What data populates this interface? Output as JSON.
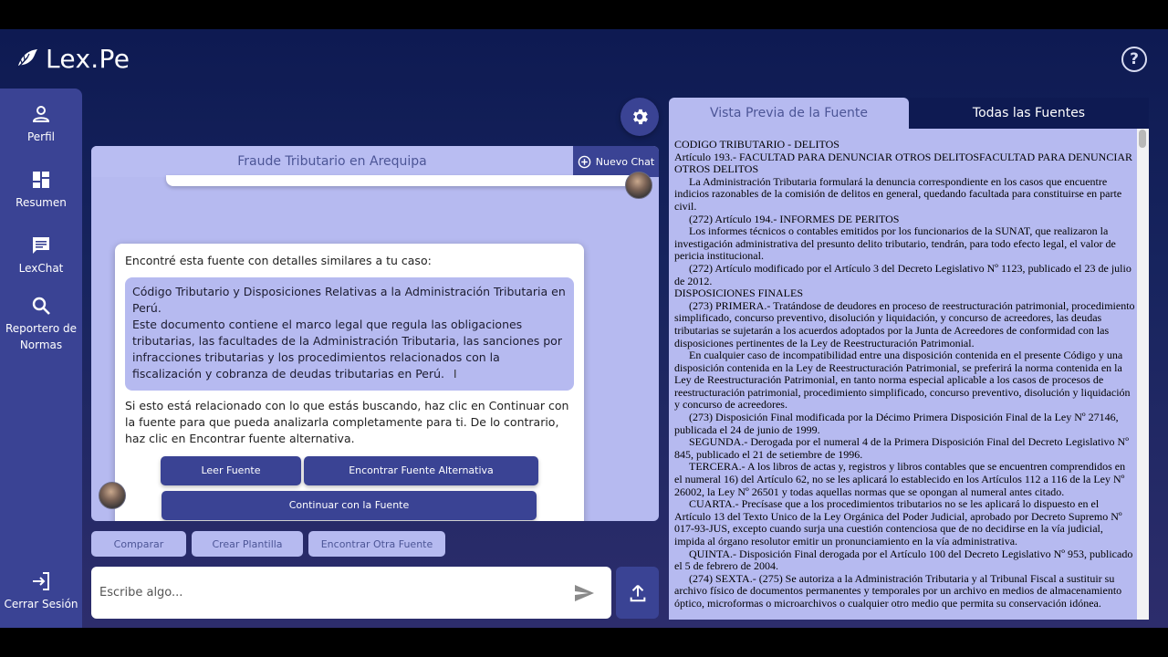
{
  "app": {
    "logo_text": "Lex.Pe"
  },
  "sidebar": {
    "items": [
      {
        "label": "Perfil",
        "icon": "person-icon"
      },
      {
        "label": "Resumen",
        "icon": "dashboard-icon"
      },
      {
        "label": "LexChat",
        "icon": "chat-icon"
      },
      {
        "label": "Reportero de Normas",
        "icon": "search-icon"
      }
    ],
    "logout_label": "Cerrar Sesión"
  },
  "chat": {
    "title": "Fraude Tributario en Arequipa",
    "new_chat_label": "Nuevo Chat",
    "bot_message": {
      "intro": "Encontré esta fuente con detalles similares a tu caso:",
      "source_title": "Código Tributario y Disposiciones Relativas a la Administración Tributaria en Perú.",
      "source_description": "Este documento contiene el marco legal que regula las obligaciones tributarias, las facultades de la Administración Tributaria, las sanciones por infracciones tributarias y los procedimientos relacionados con la fiscalización y cobranza de deudas tributarias en Perú.",
      "followup": "Si esto está relacionado con lo que estás buscando, haz clic en Continuar con la fuente para que pueda analizarla completamente para ti. De lo contrario, haz clic en Encontrar fuente alternativa.",
      "buttons": {
        "read": "Leer Fuente",
        "alternative": "Encontrar Fuente Alternativa",
        "continue": "Continuar con la Fuente"
      }
    },
    "quick_actions": [
      "Comparar",
      "Crear Plantilla",
      "Encontrar Otra Fuente"
    ],
    "input_placeholder": "Escribe algo..."
  },
  "source_panel": {
    "tabs": [
      "Vista Previa de la Fuente",
      "Todas las Fuentes"
    ],
    "paragraphs": [
      {
        "text": "CODIGO TRIBUTARIO - DELITOS",
        "indent": false
      },
      {
        "text": "Artículo 193.- FACULTAD PARA DENUNCIAR OTROS DELITOSFACULTAD PARA DENUNCIAR OTROS DELITOS",
        "indent": false
      },
      {
        "text": "La Administración Tributaria formulará la denuncia correspondiente en los casos que encuentre indicios razonables de la comisión de delitos en general, quedando facultada para constituirse en parte civil.",
        "indent": true
      },
      {
        "text": "(272) Artículo 194.- INFORMES DE PERITOS",
        "indent": true
      },
      {
        "text": "Los informes técnicos o contables emitidos por los funcionarios de la SUNAT, que realizaron la investigación administrativa del presunto delito tributario, tendrán, para todo efecto legal, el valor de pericia institucional.",
        "indent": true
      },
      {
        "text": "(272) Artículo modificado por el Artículo 3 del Decreto Legislativo Nº 1123, publicado el 23 de julio de 2012.",
        "indent": true
      },
      {
        "text": "DISPOSICIONES FINALES",
        "indent": false
      },
      {
        "text": "(273) PRIMERA.- Tratándose de deudores en proceso de reestructuración patrimonial, procedimiento simplificado, concurso preventivo, disolución y liquidación, y concurso de acreedores, las deudas tributarias se sujetarán a los acuerdos adoptados por la Junta de Acreedores de conformidad con las disposiciones pertinentes de la Ley de Reestructuración Patrimonial.",
        "indent": true
      },
      {
        "text": "En cualquier caso de incompatibilidad entre una disposición contenida en el presente Código y una disposición contenida en la Ley de Reestructuración Patrimonial, se preferirá la norma contenida en la Ley de Reestructuración Patrimonial, en tanto norma especial aplicable a los casos de procesos de reestructuración patrimonial, procedimiento simplificado, concurso preventivo, disolución y liquidación y concurso de acreedores.",
        "indent": true
      },
      {
        "text": "(273) Disposición Final modificada por la Décimo Primera Disposición Final de la Ley Nº 27146, publicada el 24 de junio de 1999.",
        "indent": true
      },
      {
        "text": "SEGUNDA.- Derogada por el numeral 4 de la Primera Disposición Final del Decreto Legislativo Nº 845, publicado el 21 de setiembre de 1996.",
        "indent": true
      },
      {
        "text": "TERCERA.- A los libros de actas y, registros y libros contables que se encuentren comprendidos en el numeral 16) del Artículo 62, no se les aplicará lo establecido en los Artículos 112 a 116 de la Ley Nº 26002, la Ley Nº 26501 y todas aquellas normas que se opongan al numeral antes citado.",
        "indent": true
      },
      {
        "text": "CUARTA.- Precísase que a los procedimientos tributarios no se les aplicará lo dispuesto en el Artículo 13 del Texto Unico de la Ley Orgánica del Poder Judicial, aprobado por Decreto Supremo Nº 017-93-JUS, excepto cuando surja una cuestión contenciosa que de no decidirse en la vía judicial, impida al órgano resolutor emitir un pronunciamiento en la vía administrativa.",
        "indent": true
      },
      {
        "text": "QUINTA.- Disposición Final derogada por el Artículo 100 del Decreto Legislativo Nº 953, publicado el 5 de febrero de 2004.",
        "indent": true
      },
      {
        "text": "(274) SEXTA.- (275) Se autoriza a la Administración Tributaria y al Tribunal Fiscal a sustituir su archivo físico de documentos permanentes y temporales por un archivo en medios de almacenamiento óptico, microformas o microarchivos o cualquier otro medio que permita su conservación idónea.",
        "indent": true
      }
    ]
  },
  "colors": {
    "sidebar": "#3a4394",
    "panel": "#b6baf0",
    "accent_button": "#3a4394",
    "background_top": "#0e1a52"
  }
}
